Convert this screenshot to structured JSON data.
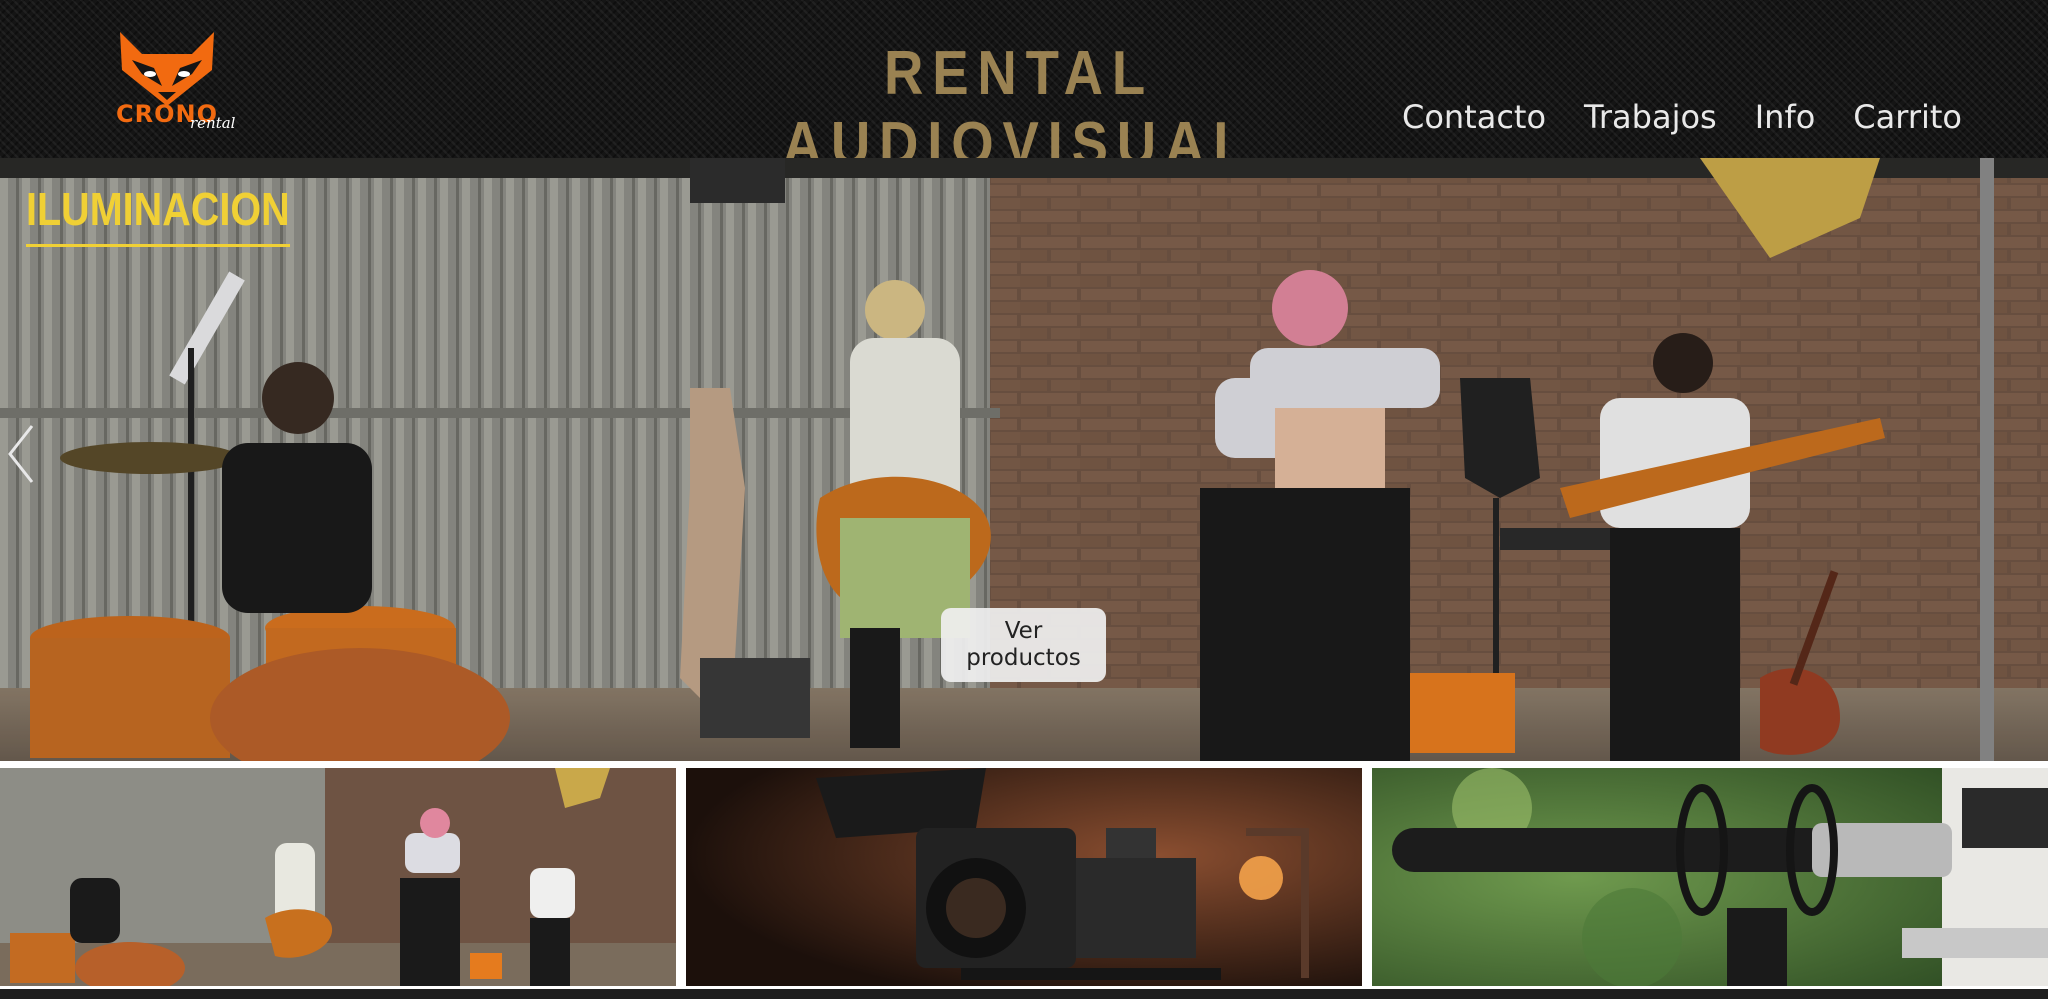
{
  "header": {
    "logo_text": "CRONO",
    "logo_sub": "rental",
    "site_title": "RENTAL AUDIOVISUAL",
    "nav": [
      "Contacto",
      "Trabajos",
      "Info",
      "Carrito"
    ]
  },
  "hero": {
    "slide_title": "ILUMINACION",
    "button_label": "Ver\nproductos"
  },
  "thumbnails": [
    {
      "subject": "band-rehearsal-photo"
    },
    {
      "subject": "cinema-camera-photo"
    },
    {
      "subject": "shotgun-microphone-photo"
    }
  ],
  "colors": {
    "header_bg": "#151515",
    "title_gold": "#9a8252",
    "slide_title_yellow": "#f0d035",
    "logo_orange": "#f26a10",
    "nav_text": "#e9e9e9"
  }
}
